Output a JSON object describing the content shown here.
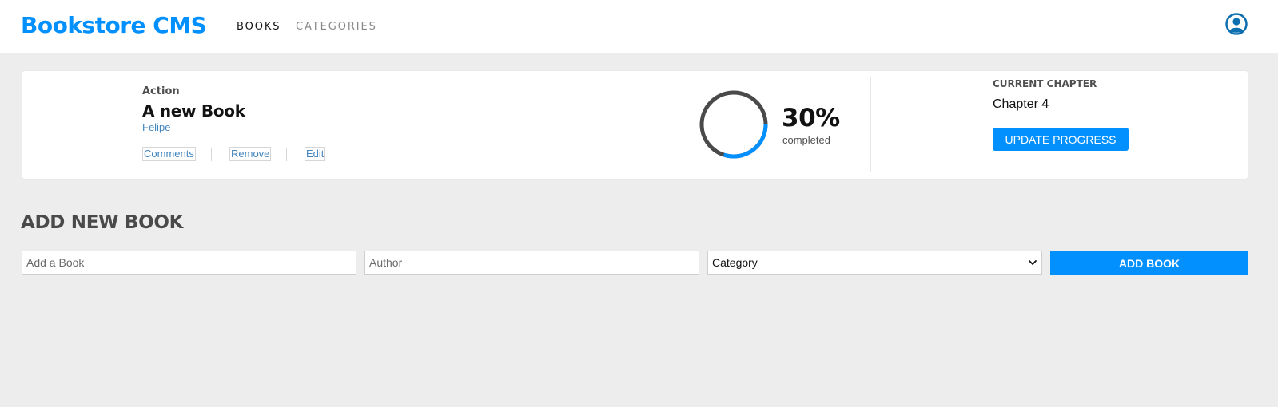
{
  "header": {
    "logo": "Bookstore CMS",
    "nav": [
      {
        "label": "BOOKS"
      },
      {
        "label": "CATEGORIES"
      }
    ]
  },
  "book": {
    "genre": "Action",
    "title": "A new Book",
    "author": "Felipe",
    "actions": {
      "comments": "Comments",
      "remove": "Remove",
      "edit": "Edit"
    },
    "progress_percent": 30,
    "progress_label": "30%",
    "completed_label": "completed",
    "current_chapter_label": "CURRENT CHAPTER",
    "current_chapter": "Chapter 4",
    "update_button": "UPDATE PROGRESS"
  },
  "form": {
    "title": "ADD NEW BOOK",
    "book_placeholder": "Add a Book",
    "author_placeholder": "Author",
    "category_selected": "Category",
    "submit_label": "ADD BOOK"
  },
  "colors": {
    "accent": "#0290ff",
    "link": "#4386bf",
    "ring_track": "#4a4a4a",
    "background": "#ededed"
  },
  "icons": {
    "avatar": "user-circle-icon",
    "select_arrow": "chevron-down-icon"
  }
}
